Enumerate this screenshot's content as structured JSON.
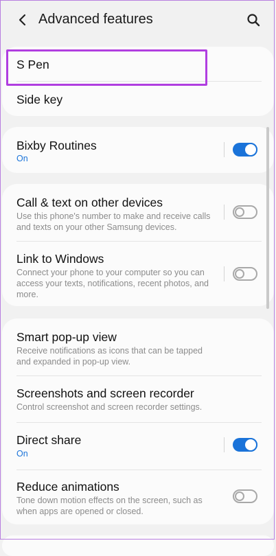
{
  "header": {
    "title": "Advanced features",
    "back_icon": "back-arrow-icon",
    "search_icon": "search-icon"
  },
  "group1": {
    "s_pen": "S Pen",
    "side_key": "Side key"
  },
  "group2": {
    "bixby_title": "Bixby Routines",
    "bixby_status": "On",
    "bixby_enabled": true
  },
  "group3": {
    "call_title": "Call & text on other devices",
    "call_desc": "Use this phone's number to make and receive calls and texts on your other Samsung devices.",
    "call_enabled": false,
    "link_title": "Link to Windows",
    "link_desc": "Connect your phone to your computer so you can access your texts, notifications, recent photos, and more.",
    "link_enabled": false
  },
  "group4": {
    "smart_title": "Smart pop-up view",
    "smart_desc": "Receive notifications as icons that can be tapped and expanded in pop-up view.",
    "screenshots_title": "Screenshots and screen recorder",
    "screenshots_desc": "Control screenshot and screen recorder settings.",
    "direct_title": "Direct share",
    "direct_status": "On",
    "direct_enabled": true,
    "reduce_title": "Reduce animations",
    "reduce_desc": "Tone down motion effects on the screen, such as when apps are opened or closed.",
    "reduce_enabled": false
  },
  "colors": {
    "accent": "#1a73d9",
    "highlight": "#b03ee0",
    "background": "#f1f1f1"
  }
}
